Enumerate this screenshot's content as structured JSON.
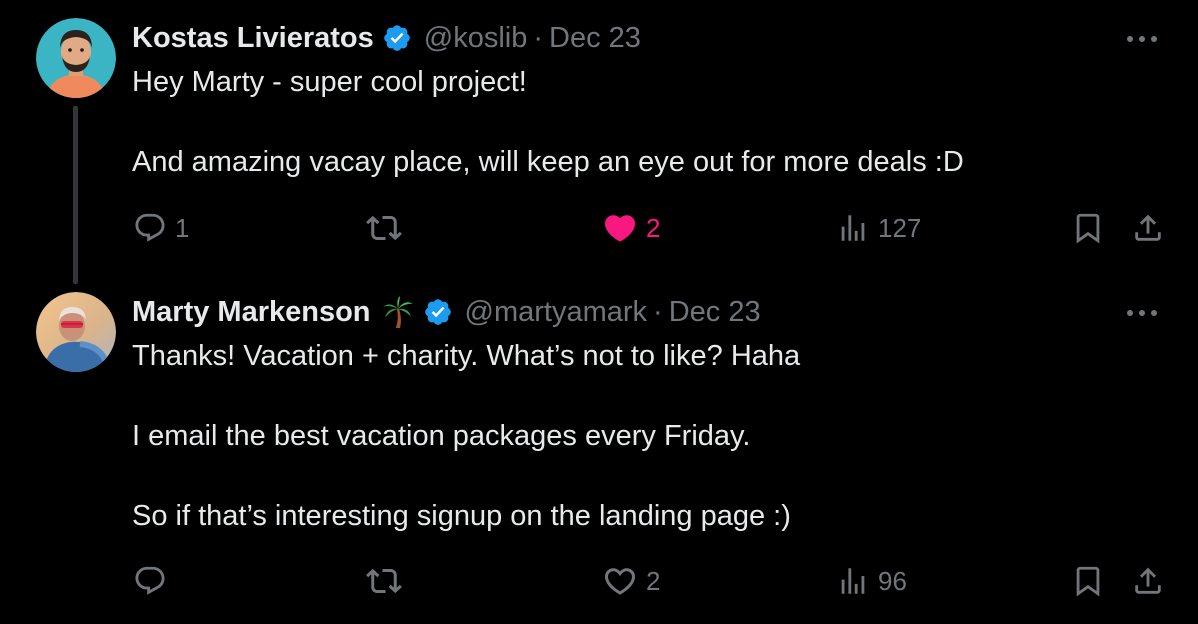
{
  "tweets": [
    {
      "author_name": "Kostas Livieratos",
      "handle": "@koslib",
      "separator": "·",
      "date": "Dec 23",
      "paragraphs": [
        "Hey Marty - super cool project!",
        "And amazing vacay place, will keep an eye out for more deals :D"
      ],
      "reply_count": "1",
      "retweet_count": "",
      "like_count": "2",
      "liked": true,
      "view_count": "127"
    },
    {
      "author_name": "Marty Markenson",
      "name_emoji": "palm-tree",
      "handle": "@martyamark",
      "separator": "·",
      "date": "Dec 23",
      "paragraphs": [
        "Thanks! Vacation + charity. What’s not to like? Haha",
        "I email the best vacation packages every Friday.",
        "So if that’s interesting signup on the landing page :)"
      ],
      "reply_count": "",
      "retweet_count": "",
      "like_count": "2",
      "liked": false,
      "view_count": "96"
    }
  ],
  "colors": {
    "background": "#000000",
    "text": "#e7e9ea",
    "muted": "#71767b",
    "verified": "#1d9bf0",
    "like": "#f91880",
    "thread_line": "#333639"
  }
}
